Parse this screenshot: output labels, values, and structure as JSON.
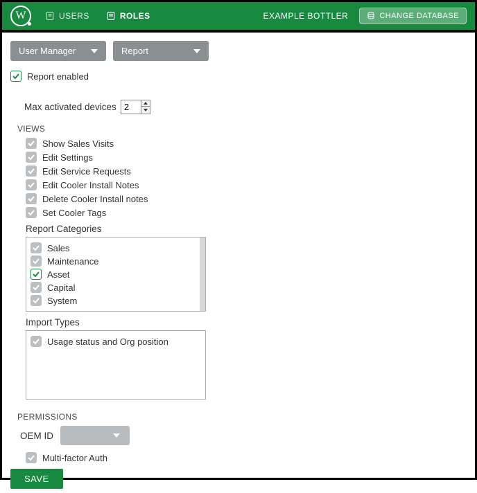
{
  "topbar": {
    "nav_users": "USERS",
    "nav_roles": "ROLES",
    "brand": "EXAMPLE BOTTLER",
    "change_db": "CHANGE DATABASE"
  },
  "dropdowns": {
    "module": "User Manager",
    "view": "Report"
  },
  "report_enabled_label": "Report enabled",
  "max_devices_label": "Max activated devices",
  "max_devices_value": "2",
  "views": {
    "heading": "VIEWS",
    "items": [
      "Show Sales Visits",
      "Edit Settings",
      "Edit Service Requests",
      "Edit Cooler Install Notes",
      "Delete Cooler Install notes",
      "Set Cooler Tags"
    ]
  },
  "report_categories": {
    "heading": "Report Categories",
    "items": [
      "Sales",
      "Maintenance",
      "Asset",
      "Capital",
      "System"
    ],
    "checked_index": 2
  },
  "import_types": {
    "heading": "Import Types",
    "items": [
      "Usage status and Org position"
    ]
  },
  "permissions": {
    "heading": "PERMISSIONS",
    "oem_label": "OEM ID",
    "mfa_label": "Multi-factor Auth"
  },
  "save_label": "SAVE"
}
